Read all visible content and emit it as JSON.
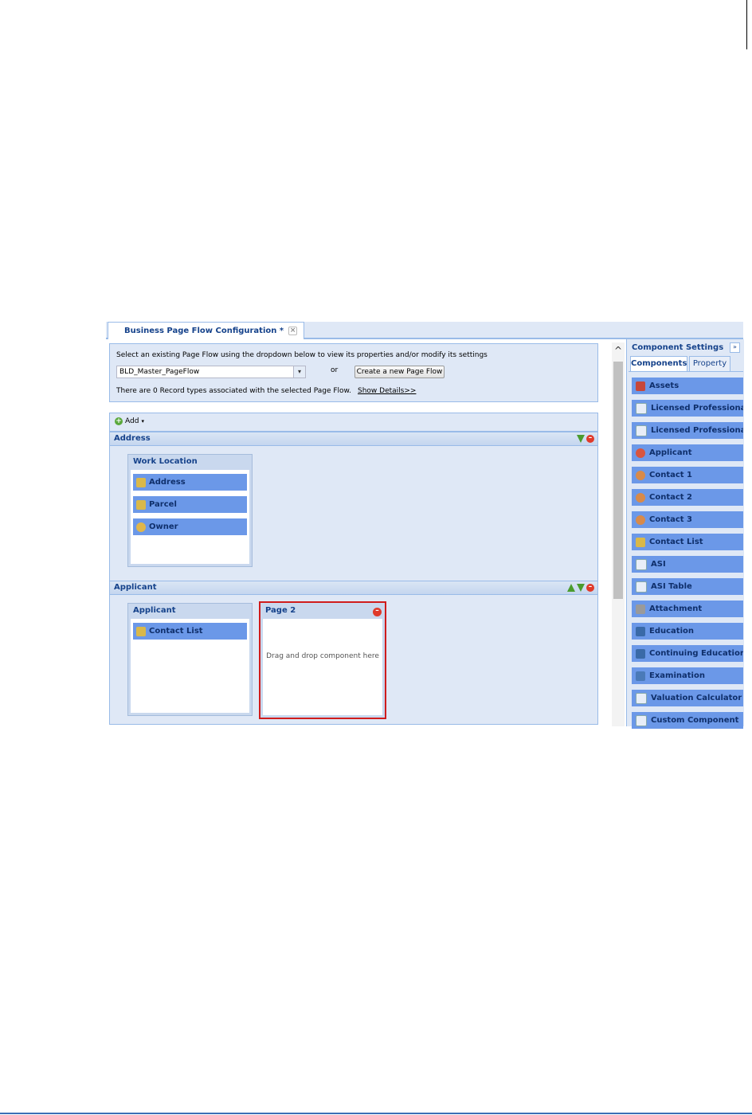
{
  "tab": {
    "title": "Business Page Flow Configuration *",
    "close": "×"
  },
  "selector": {
    "instruction": "Select an existing Page Flow using the dropdown below to view its properties and/or modify its settings",
    "dropdown_value": "BLD_Master_PageFlow",
    "or_label": "or",
    "create_button": "Create a new Page Flow",
    "record_info": "There are 0 Record types associated with the selected Page Flow.",
    "details_link": "Show Details>>"
  },
  "toolbar": {
    "add_label": "Add"
  },
  "steps": [
    {
      "name": "Address",
      "pages": [
        {
          "title": "Work Location",
          "components": [
            "Address",
            "Parcel",
            "Owner"
          ]
        }
      ]
    },
    {
      "name": "Applicant",
      "pages": [
        {
          "title": "Applicant",
          "components": [
            "Contact List"
          ]
        },
        {
          "title": "Page 2",
          "placeholder": "Drag and drop component here"
        }
      ]
    }
  ],
  "component_panel": {
    "title": "Component Settings",
    "tabs": [
      "Components",
      "Property"
    ],
    "items": [
      "Assets",
      "Licensed Professional",
      "Licensed Professional List",
      "Applicant",
      "Contact 1",
      "Contact 2",
      "Contact 3",
      "Contact List",
      "ASI",
      "ASI Table",
      "Attachment",
      "Education",
      "Continuing Education",
      "Examination",
      "Valuation Calculator",
      "Custom Component"
    ]
  },
  "colors": {
    "accent": "#15428b",
    "component_fill": "#6b98e8",
    "panel_bg": "#dfe8f6",
    "highlight_border": "#d01c1c"
  }
}
